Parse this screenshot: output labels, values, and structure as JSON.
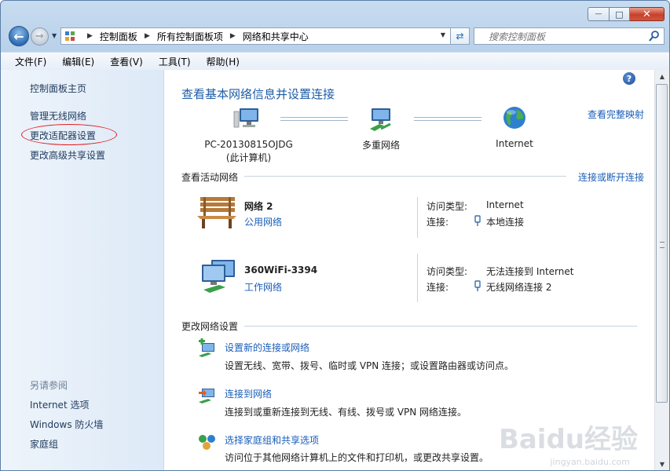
{
  "window": {
    "caption_buttons": {
      "minimize": "—",
      "maximize": "□",
      "close": "✕"
    }
  },
  "nav": {
    "breadcrumb": [
      "控制面板",
      "所有控制面板项",
      "网络和共享中心"
    ],
    "search_placeholder": "搜索控制面板"
  },
  "menu": [
    "文件(F)",
    "编辑(E)",
    "查看(V)",
    "工具(T)",
    "帮助(H)"
  ],
  "sidebar": {
    "home": "控制面板主页",
    "items": [
      "管理无线网络",
      "更改适配器设置",
      "更改高级共享设置"
    ],
    "see_also_label": "另请参阅",
    "see_also": [
      "Internet 选项",
      "Windows 防火墙",
      "家庭组"
    ]
  },
  "main": {
    "title": "查看基本网络信息并设置连接",
    "full_map": "查看完整映射",
    "map": {
      "pc_name": "PC-20130815OJDG",
      "pc_sub": "(此计算机)",
      "middle": "多重网络",
      "internet": "Internet"
    },
    "active_header": "查看活动网络",
    "connect_disconnect": "连接或断开连接",
    "networks": [
      {
        "name": "网络  2",
        "type": "公用网络",
        "access_label": "访问类型:",
        "access": "Internet",
        "conn_label": "连接:",
        "conn": "本地连接"
      },
      {
        "name": "360WiFi-3394",
        "type": "工作网络",
        "access_label": "访问类型:",
        "access": "无法连接到 Internet",
        "conn_label": "连接:",
        "conn": "无线网络连接 2"
      }
    ],
    "change_header": "更改网络设置",
    "tasks": [
      {
        "title": "设置新的连接或网络",
        "desc": "设置无线、宽带、拨号、临时或 VPN 连接；或设置路由器或访问点。"
      },
      {
        "title": "连接到网络",
        "desc": "连接到或重新连接到无线、有线、拨号或 VPN 网络连接。"
      },
      {
        "title": "选择家庭组和共享选项",
        "desc": "访问位于其他网络计算机上的文件和打印机，或更改共享设置。"
      }
    ]
  },
  "watermark": {
    "brand": "Baidu经验",
    "url": "jingyan.baidu.com"
  }
}
